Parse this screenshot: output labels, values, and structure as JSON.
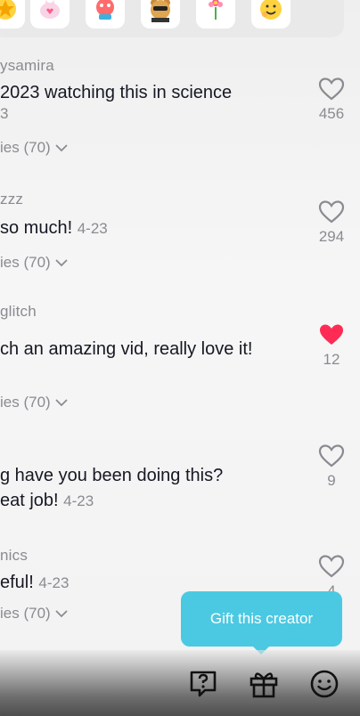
{
  "stickers": [
    {
      "icon": "star-sticker-icon"
    },
    {
      "icon": "heart-cat-sticker-icon"
    },
    {
      "icon": "dancing-face-sticker-icon"
    },
    {
      "icon": "cool-bear-sticker-icon"
    },
    {
      "icon": "flower-sticker-icon"
    },
    {
      "icon": "hugging-face-sticker-icon"
    }
  ],
  "comments": [
    {
      "username": "ysamira",
      "text": "2023 watching this in science",
      "subline": "3",
      "replies_label": "ies (70)",
      "likes": "456",
      "liked": false
    },
    {
      "username": "zzz",
      "text": " so much!",
      "date": "4-23",
      "replies_label": "ies (70)",
      "likes": "294",
      "liked": false
    },
    {
      "username": "glitch",
      "text": "ch an amazing vid, really love it!",
      "replies_label": "ies (70)",
      "likes": "12",
      "liked": true
    },
    {
      "text": "g have you been doing this?",
      "text2": "eat job!",
      "date": "4-23",
      "likes": "9",
      "liked": false
    },
    {
      "username": "nics",
      "text": "eful!",
      "date": "4-23",
      "replies_label": "ies (70)",
      "likes": "4",
      "liked": false
    }
  ],
  "tooltip": {
    "label": "Gift this creator"
  },
  "bottom_bar": {
    "icons": [
      "question-box-icon",
      "gift-icon",
      "emoji-icon"
    ]
  },
  "colors": {
    "liked_heart": "#fe2c55",
    "tooltip_bg": "#4bc9e2",
    "secondary_text": "#8a8b91"
  }
}
